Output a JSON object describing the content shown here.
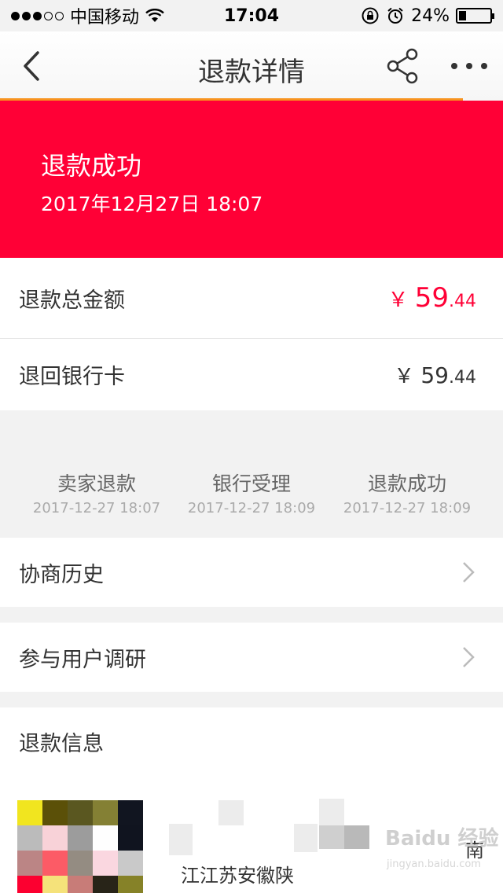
{
  "status_bar": {
    "carrier": "中国移动",
    "time": "17:04",
    "battery_percent": "24%",
    "battery_level": 0.24
  },
  "nav": {
    "title": "退款详情",
    "progress": 0.92
  },
  "banner": {
    "status": "退款成功",
    "datetime": "2017年12月27日 18:07"
  },
  "refund_total": {
    "label": "退款总金额",
    "currency": "￥",
    "integer": "59",
    "decimal": ".44"
  },
  "refund_card": {
    "label": "退回银行卡",
    "currency": "￥",
    "integer": "59",
    "decimal": ".44"
  },
  "timeline": [
    {
      "label": "卖家退款",
      "time": "2017-12-27 18:07"
    },
    {
      "label": "银行受理",
      "time": "2017-12-27 18:09"
    },
    {
      "label": "退款成功",
      "time": "2017-12-27 18:09"
    }
  ],
  "menu": {
    "history": "协商历史",
    "survey": "参与用户调研"
  },
  "refund_info": {
    "title": "退款信息",
    "address_line": "江江苏安徽陕",
    "address_end": "南"
  },
  "watermark": {
    "text": "Baidu 经验",
    "sub": "jingyan.baidu.com"
  },
  "colors": {
    "accent": "#ff0036",
    "progress": "#f7931e"
  }
}
